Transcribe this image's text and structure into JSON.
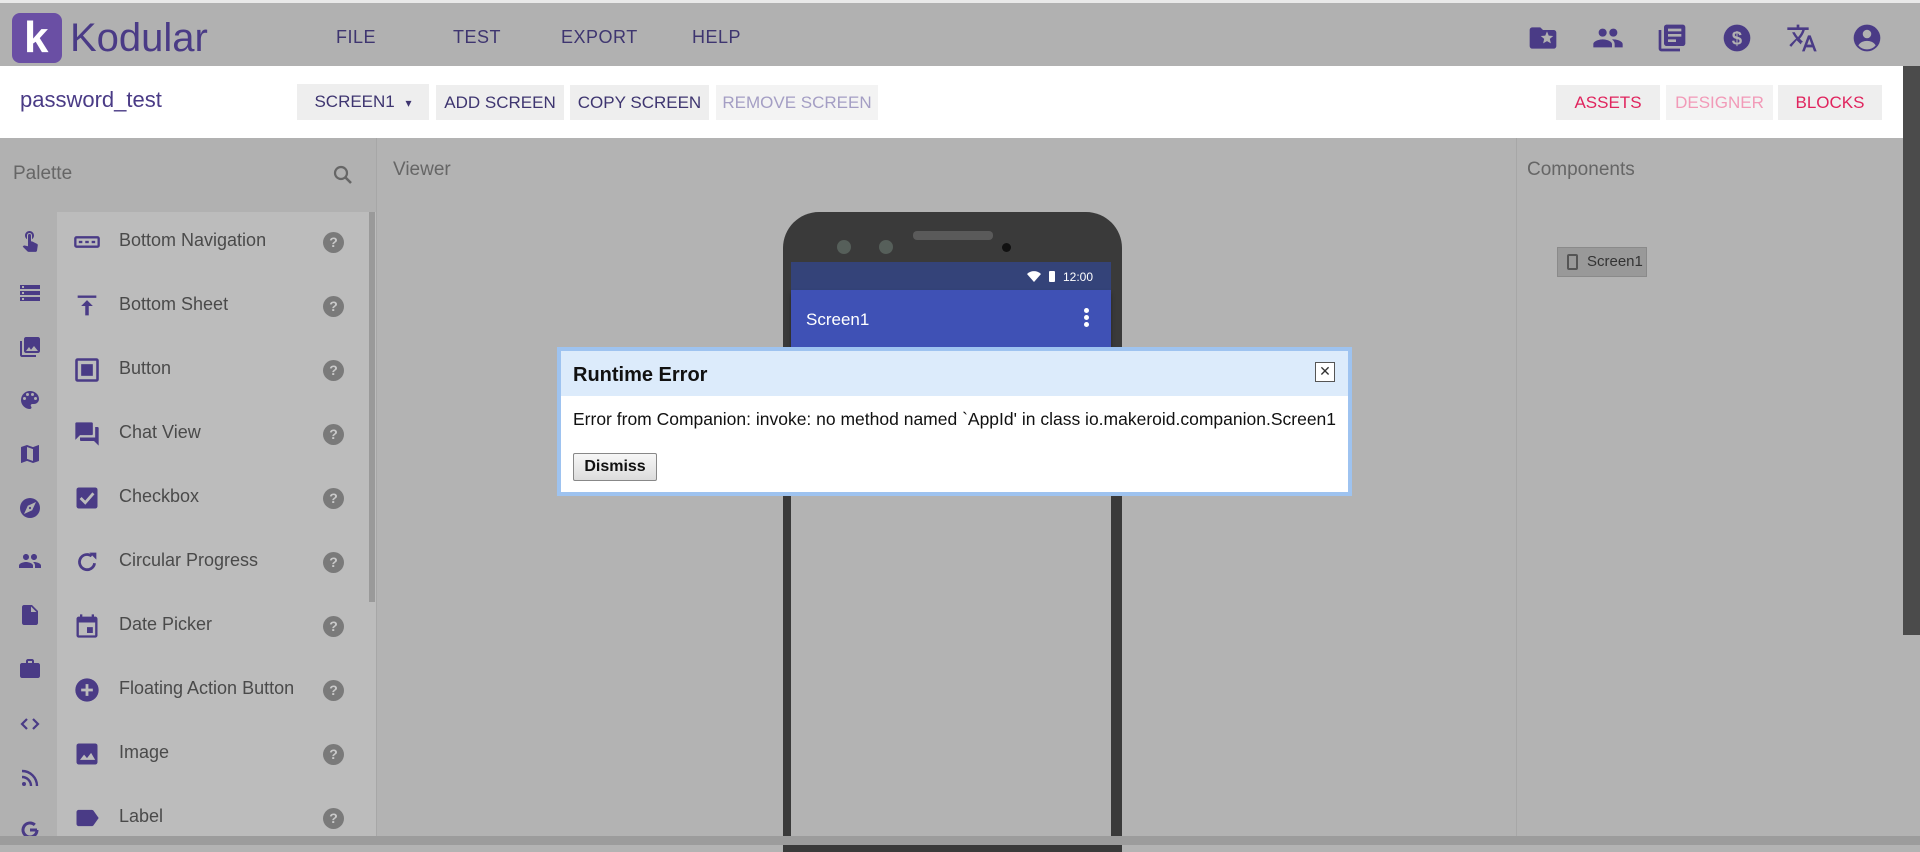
{
  "app": {
    "logo_letter": "k",
    "name": "Kodular"
  },
  "top_menu": [
    "FILE",
    "TEST",
    "EXPORT",
    "HELP"
  ],
  "top_icons": [
    "folder-star-icon",
    "people-icon",
    "library-icon",
    "dollar-icon",
    "translate-icon",
    "account-icon"
  ],
  "project": {
    "name": "password_test"
  },
  "screen_selector": {
    "label": "SCREEN1",
    "caret": "▾"
  },
  "screen_actions": {
    "add": "ADD SCREEN",
    "copy": "COPY SCREEN",
    "remove": "REMOVE SCREEN"
  },
  "view_tabs": {
    "assets": "ASSETS",
    "designer": "DESIGNER",
    "blocks": "BLOCKS"
  },
  "palette": {
    "title": "Palette",
    "categories": [
      "touch-icon",
      "storage-icon",
      "media-icon",
      "palette-icon",
      "map-icon",
      "compass-icon",
      "people-icon",
      "document-icon",
      "briefcase-icon",
      "code-icon",
      "rss-icon",
      "google-icon"
    ],
    "items": [
      {
        "label": "Bottom Navigation",
        "icon": "bottom-navigation-icon"
      },
      {
        "label": "Bottom Sheet",
        "icon": "bottom-sheet-icon"
      },
      {
        "label": "Button",
        "icon": "button-icon"
      },
      {
        "label": "Chat View",
        "icon": "chat-icon"
      },
      {
        "label": "Checkbox",
        "icon": "checkbox-icon"
      },
      {
        "label": "Circular Progress",
        "icon": "circular-progress-icon"
      },
      {
        "label": "Date Picker",
        "icon": "date-picker-icon"
      },
      {
        "label": "Floating Action Button",
        "icon": "add-circle-icon"
      },
      {
        "label": "Image",
        "icon": "image-icon"
      },
      {
        "label": "Label",
        "icon": "label-icon"
      }
    ],
    "help_glyph": "?"
  },
  "viewer": {
    "title": "Viewer",
    "phone": {
      "time": "12:00",
      "screen_title": "Screen1"
    }
  },
  "components": {
    "title": "Components",
    "tree": [
      "Screen1"
    ]
  },
  "dialog": {
    "title": "Runtime Error",
    "close_glyph": "✕",
    "message": "Error from Companion: invoke: no method named `AppId' in class io.makeroid.companion.Screen1",
    "dismiss": "Dismiss"
  },
  "colors": {
    "brand": "#6a4fa4",
    "accent_pink": "#e0245e",
    "appbar": "#3f51b5"
  }
}
